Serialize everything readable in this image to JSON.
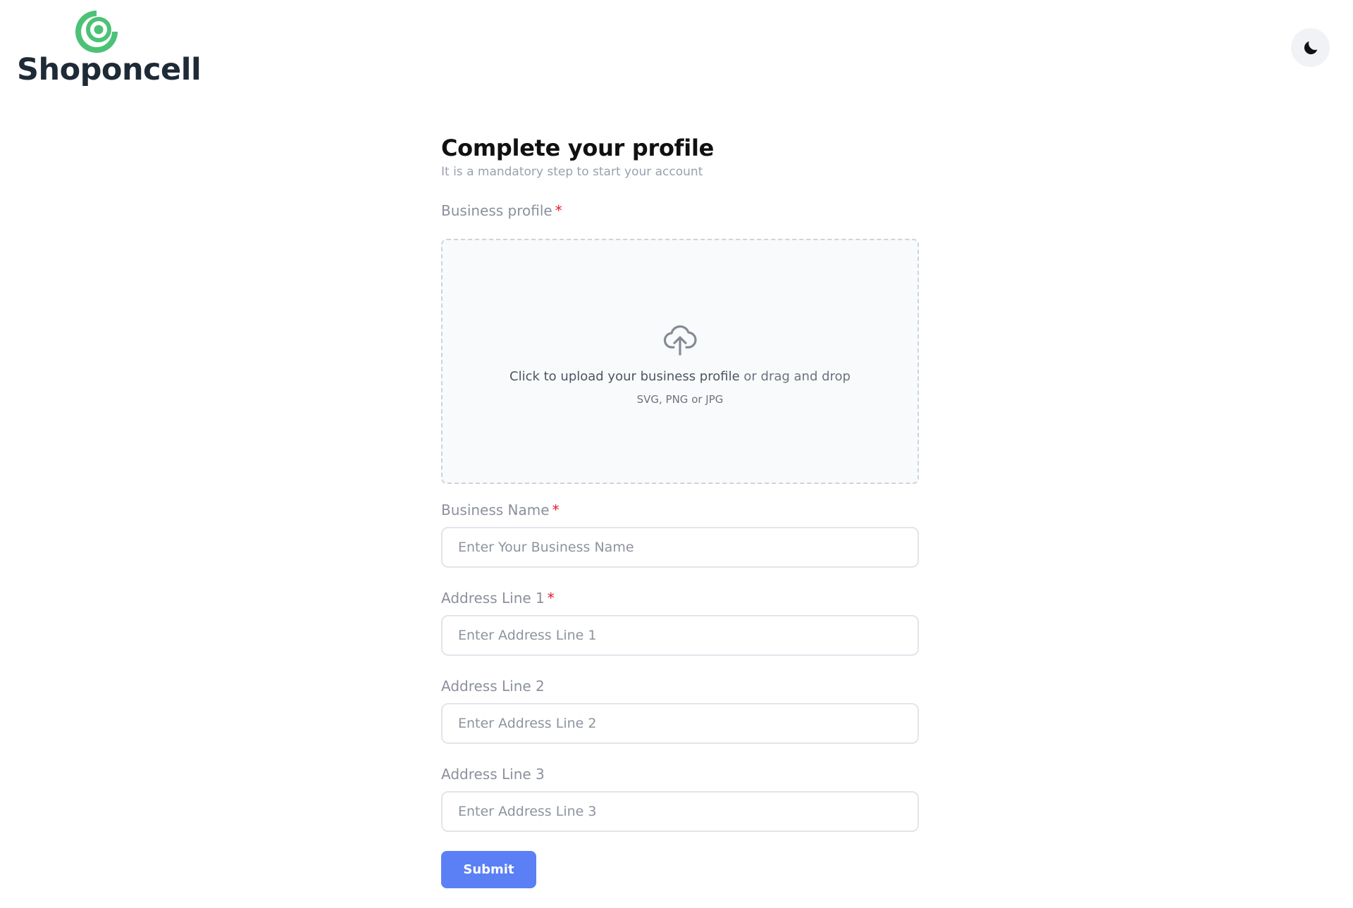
{
  "brand": {
    "name": "Shoponcell",
    "accent_color": "#4cc277",
    "logo_icon": "concentric-circle-logo"
  },
  "header": {
    "theme_toggle_icon": "moon-icon"
  },
  "form": {
    "title": "Complete your profile",
    "subtitle": "It is a mandatory step to start your account",
    "business_profile": {
      "label": "Business profile",
      "required_mark": "*",
      "upload_icon": "cloud-upload-icon",
      "upload_action": "Click to upload your business profile",
      "upload_alt": " or drag and drop",
      "formats": "SVG, PNG or JPG"
    },
    "business_name": {
      "label": "Business Name",
      "required_mark": "*",
      "value": "",
      "placeholder": "Enter Your Business Name"
    },
    "address_line_1": {
      "label": "Address Line 1",
      "required_mark": "*",
      "value": "",
      "placeholder": "Enter Address Line 1"
    },
    "address_line_2": {
      "label": "Address Line 2",
      "value": "",
      "placeholder": "Enter Address Line 2"
    },
    "address_line_3": {
      "label": "Address Line 3",
      "value": "",
      "placeholder": "Enter Address Line 3"
    },
    "submit_label": "Submit",
    "submit_color": "#5b7ff4",
    "required_color": "#e11d2a"
  }
}
